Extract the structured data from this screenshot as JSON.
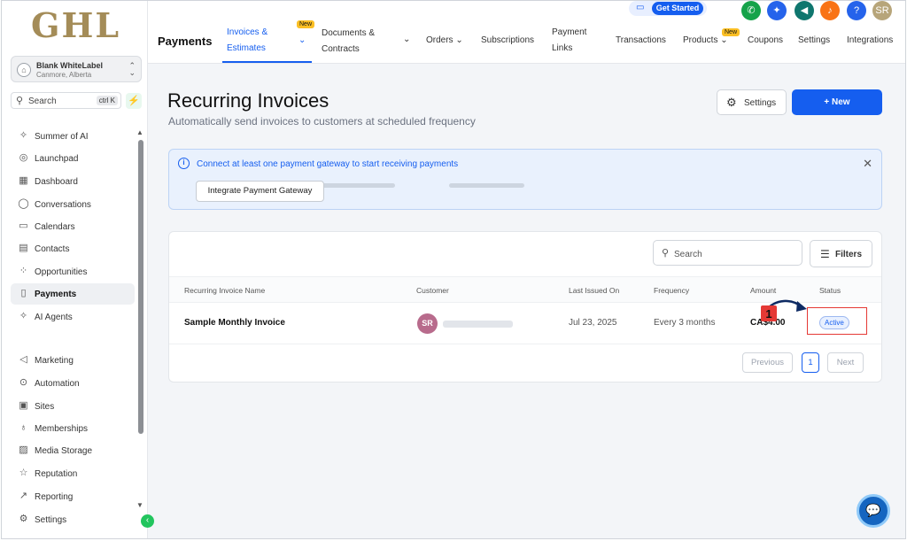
{
  "sidebar": {
    "logo": "GHL",
    "account": {
      "name": "Blank WhiteLabel",
      "location": "Canmore, Alberta"
    },
    "search": {
      "placeholder": "Search",
      "shortcut": "ctrl K"
    },
    "items_top": [
      {
        "label": "Summer of AI",
        "icon": "sparkle-icon"
      },
      {
        "label": "Launchpad",
        "icon": "rocket-icon"
      },
      {
        "label": "Dashboard",
        "icon": "grid-icon"
      },
      {
        "label": "Conversations",
        "icon": "chat-icon"
      },
      {
        "label": "Calendars",
        "icon": "calendar-icon"
      },
      {
        "label": "Contacts",
        "icon": "contacts-icon"
      },
      {
        "label": "Opportunities",
        "icon": "funnel-icon"
      },
      {
        "label": "Payments",
        "icon": "receipt-icon",
        "active": true
      },
      {
        "label": "AI Agents",
        "icon": "sparkle-icon"
      }
    ],
    "items_bottom": [
      {
        "label": "Marketing",
        "icon": "send-icon"
      },
      {
        "label": "Automation",
        "icon": "automation-icon"
      },
      {
        "label": "Sites",
        "icon": "sites-icon"
      },
      {
        "label": "Memberships",
        "icon": "award-icon"
      },
      {
        "label": "Media Storage",
        "icon": "image-icon"
      },
      {
        "label": "Reputation",
        "icon": "star-icon"
      },
      {
        "label": "Reporting",
        "icon": "trend-icon"
      },
      {
        "label": "Settings",
        "icon": "gear-icon"
      }
    ]
  },
  "topbar": {
    "title": "Payments",
    "new_badge": "New",
    "tabs": {
      "invoices_l1": "Invoices &",
      "invoices_l2": "Estimates",
      "documents_l1": "Documents &",
      "documents_l2": "Contracts",
      "orders": "Orders",
      "subscriptions": "Subscriptions",
      "payment_links_l1": "Payment",
      "payment_links_l2": "Links",
      "transactions": "Transactions",
      "products": "Products",
      "coupons": "Coupons",
      "settings": "Settings",
      "integrations": "Integrations"
    },
    "get_started": "Get Started",
    "user_initials": "SR",
    "help": "?"
  },
  "page": {
    "title": "Recurring Invoices",
    "subtitle": "Automatically send invoices to customers at scheduled frequency",
    "settings_button": "Settings",
    "new_button": "+ New"
  },
  "alert": {
    "message": "Connect at least one payment gateway to start receiving payments",
    "button": "Integrate Payment Gateway"
  },
  "table": {
    "search_placeholder": "Search",
    "filters_label": "Filters",
    "columns": [
      "Recurring Invoice Name",
      "Customer",
      "Last Issued On",
      "Frequency",
      "Amount",
      "Status"
    ],
    "rows": [
      {
        "name": "Sample Monthly Invoice",
        "customer_initials": "SR",
        "last_issued": "Jul 23, 2025",
        "frequency": "Every 3 months",
        "amount": "CA$4.00",
        "status": "Active"
      }
    ],
    "pagination": {
      "previous": "Previous",
      "page": "1",
      "next": "Next"
    }
  },
  "annotation": {
    "step": "1"
  },
  "colors": {
    "primary": "#155eef",
    "logo": "#a48c58",
    "highlight": "#e53935"
  }
}
